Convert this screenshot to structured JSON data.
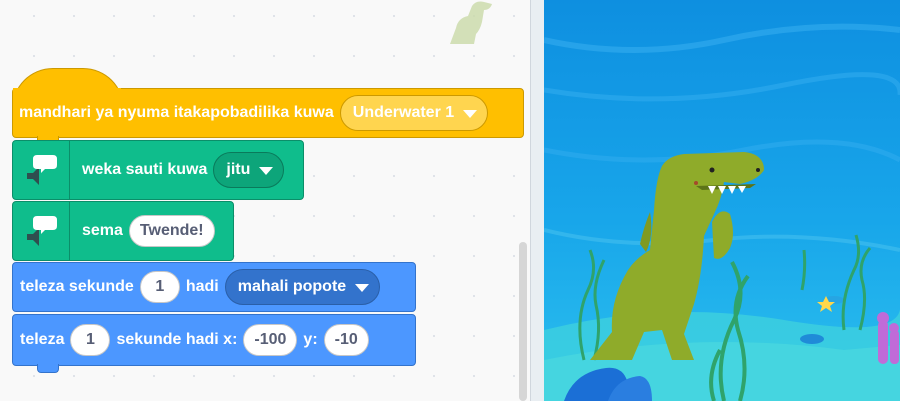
{
  "hat_block": {
    "label": "mandhari ya nyuma itakapobadilika kuwa",
    "dropdown_value": "Underwater 1"
  },
  "voice_block": {
    "label": "weka sauti kuwa",
    "dropdown_value": "jitu",
    "icon": "speech-bubble-icon"
  },
  "speak_block": {
    "label": "sema",
    "value": "Twende!",
    "icon": "speech-bubble-icon"
  },
  "glide_random_block": {
    "label_prefix": "teleza sekunde",
    "seconds": "1",
    "label_mid": "hadi",
    "dropdown_value": "mahali popote"
  },
  "glide_xy_block": {
    "label_prefix": "teleza",
    "seconds": "1",
    "label_mid": "sekunde hadi x:",
    "x": "-100",
    "label_y": "y:",
    "y": "-10"
  },
  "colors": {
    "events": "#ffbf00",
    "extension": "#0fbd8c",
    "motion": "#4c97ff",
    "stage_water": "#1aa3e8"
  }
}
